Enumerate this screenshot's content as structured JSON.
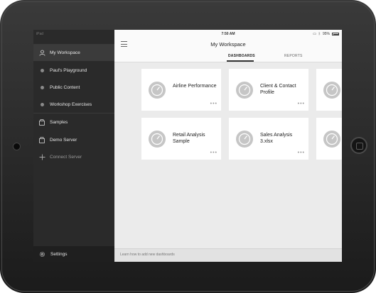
{
  "status": {
    "carrier": "iPad",
    "time": "7:50 AM",
    "battery": "95%"
  },
  "sidebar": {
    "items": [
      {
        "label": "My Workspace",
        "icon": "user-icon",
        "active": true
      },
      {
        "label": "Paul's Playground",
        "icon": "dot-icon"
      },
      {
        "label": "Public Content",
        "icon": "dot-icon"
      },
      {
        "label": "Workshop Exercises",
        "icon": "dot-icon"
      },
      {
        "label": "Samples",
        "icon": "folder-icon"
      },
      {
        "label": "Demo Server",
        "icon": "folder-icon"
      },
      {
        "label": "Connect Server",
        "icon": "plus-icon"
      }
    ],
    "settings_label": "Settings"
  },
  "header": {
    "title": "My Workspace"
  },
  "tabs": [
    {
      "label": "DASHBOARDS",
      "active": true
    },
    {
      "label": "REPORTS",
      "active": false
    }
  ],
  "cards": [
    {
      "title": "Airline Performance"
    },
    {
      "title": "Client & Contact Profile"
    },
    {
      "title": ""
    },
    {
      "title": "Retail Analysis Sample"
    },
    {
      "title": "Sales Analysis 3.xlsx"
    },
    {
      "title": ""
    }
  ],
  "footer": {
    "text": "Learn how to add new dashboards"
  },
  "colors": {
    "sidebar_bg": "#2a2a2a",
    "active_item": "#3b3b3b",
    "content_bg": "#ebebeb",
    "card_bg": "#ffffff",
    "gauge": "#c6c6c6"
  }
}
